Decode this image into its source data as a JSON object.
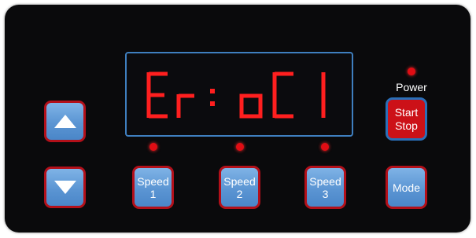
{
  "display": {
    "text": "Er: oC1",
    "color": "#ff1f1f"
  },
  "buttons": {
    "up_icon": "arrow-up-icon",
    "down_icon": "arrow-down-icon",
    "speed1": {
      "line1": "Speed",
      "line2": "1"
    },
    "speed2": {
      "line1": "Speed",
      "line2": "2"
    },
    "speed3": {
      "line1": "Speed",
      "line2": "3"
    },
    "mode": "Mode",
    "start_stop": {
      "line1": "Start",
      "line2": "Stop"
    }
  },
  "power": {
    "label": "Power",
    "led_on": true
  },
  "colors": {
    "panel": "#0a0a0c",
    "display_border": "#3f7fbf",
    "button_blue": "#5b95d3",
    "button_border": "#b3101a",
    "start_red": "#cc1118",
    "led_red": "#e10d14"
  }
}
